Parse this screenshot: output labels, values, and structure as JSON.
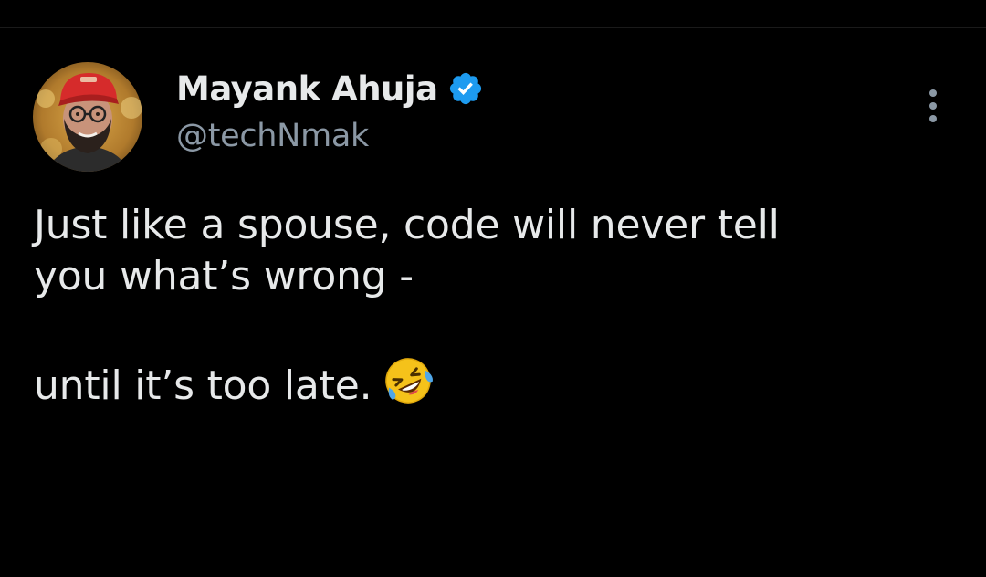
{
  "tweet": {
    "author": {
      "display_name": "Mayank Ahuja",
      "handle": "@techNmak",
      "verified": true,
      "avatar_icon": "profile-photo",
      "verified_icon": "verified-checkmark-icon"
    },
    "text_lines": [
      "Just like a spouse, code will never tell",
      "you what’s wrong -",
      "",
      "until it’s too late."
    ],
    "emoji": "rolling-on-the-floor-laughing-emoji",
    "more_icon": "more-options-icon"
  },
  "colors": {
    "background": "#000000",
    "primary_text": "#e7e9ea",
    "secondary_text": "#8b98a5",
    "verified_blue": "#1d9bf0"
  }
}
